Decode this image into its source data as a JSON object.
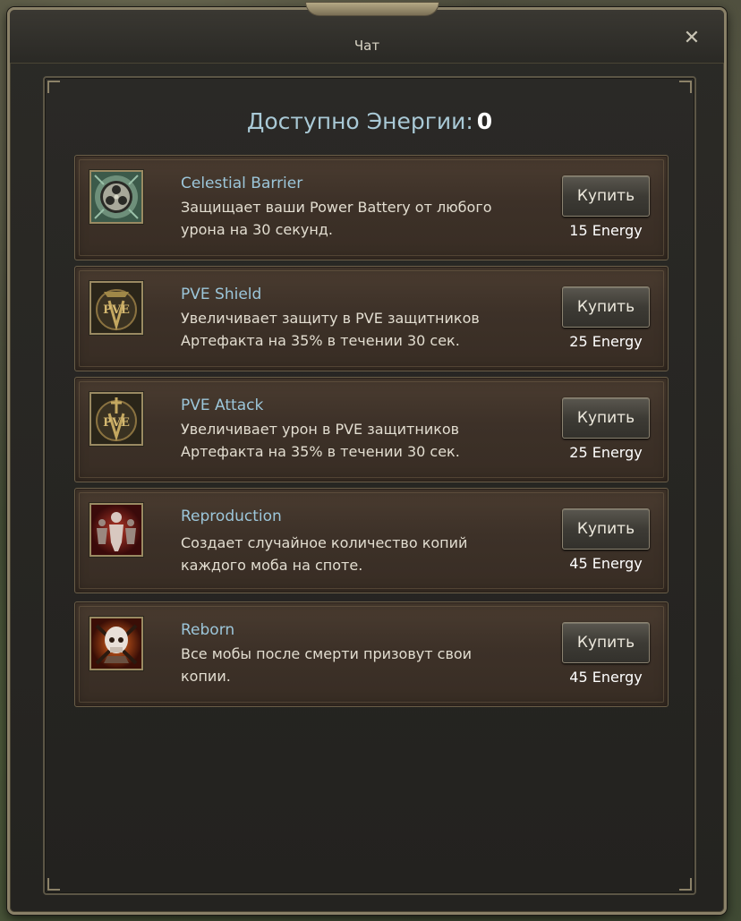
{
  "window": {
    "title": "Чат",
    "close_symbol": "✕"
  },
  "energy": {
    "label": "Доступно Энергии:",
    "value": "0"
  },
  "items": [
    {
      "name": "Celestial Barrier",
      "desc_line1": "Защищает ваши Power Battery от любого",
      "desc_line2": "урона на 30 секунд.",
      "buy_label": "Купить",
      "price": "15 Energy",
      "icon": "celestial-barrier-icon"
    },
    {
      "name": "PVE Shield",
      "desc_line1": "Увеличивает защиту в PVE защитников",
      "desc_line2": "Артефакта на 35% в течении 30 сек.",
      "buy_label": "Купить",
      "price": "25 Energy",
      "icon": "pve-shield-icon"
    },
    {
      "name": "PVE Attack",
      "desc_line1": "Увеличивает урон в PVE защитников",
      "desc_line2": "Артефакта на 35% в течении 30 сек.",
      "buy_label": "Купить",
      "price": "25 Energy",
      "icon": "pve-attack-icon"
    },
    {
      "name": "Reproduction",
      "desc_line1": "Создает случайное количество копий",
      "desc_line2": "каждого моба на споте.",
      "buy_label": "Купить",
      "price": "45 Energy",
      "icon": "reproduction-icon"
    },
    {
      "name": "Reborn",
      "desc_line1": "Все мобы после смерти призовут свои",
      "desc_line2": "копии.",
      "buy_label": "Купить",
      "price": "45 Energy",
      "icon": "reborn-icon"
    }
  ]
}
